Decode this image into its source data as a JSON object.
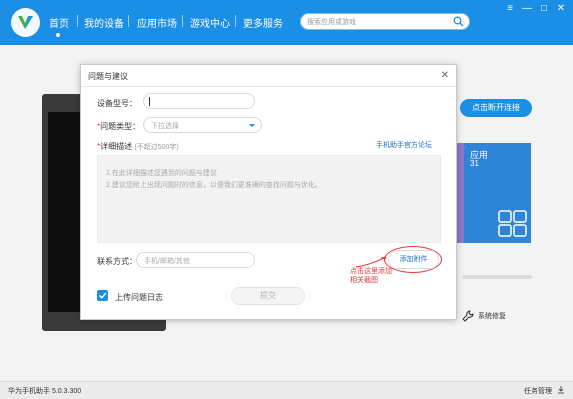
{
  "nav": {
    "items": [
      {
        "label": "首页"
      },
      {
        "label": "我的设备"
      },
      {
        "label": "应用市场"
      },
      {
        "label": "游戏中心"
      },
      {
        "label": "更多服务"
      }
    ],
    "search_placeholder": "搜索应用或游戏"
  },
  "window_controls": {
    "menu": "≡",
    "minimize": "—",
    "maximize": "□",
    "close": "✕"
  },
  "main": {
    "disconnect_button": "点击断开连接",
    "app_tile_title": "应用",
    "app_tile_count": "31",
    "system_repair": "系统修复"
  },
  "dialog": {
    "title": "问题与建议",
    "close": "✕",
    "device_model_label": "设备型号：",
    "issue_type_label": "问题类型：",
    "issue_type_placeholder": "下拉选择",
    "detail_label": "详细描述",
    "detail_hint": "(不超过500字)",
    "forum_link": "手机助手官方论坛",
    "textarea_lines": [
      "1.在此详细描述您遇到的问题与建议",
      "2.建议您附上出现问题时的信息，以便我们更准确的查找问题与优化。"
    ],
    "contact_label": "联系方式：",
    "contact_placeholder": "手机/邮箱/其他",
    "add_attachment": "添加附件",
    "upload_log_label": "上传问题日志",
    "submit": "提交"
  },
  "annotation": {
    "line1": "点击这里添加",
    "line2": "相关截图"
  },
  "status": {
    "version": "华为手机助手 5.0.3.300",
    "task_manager": "任务管理"
  },
  "colors": {
    "brand_blue": "#1b8fe6",
    "annotation_red": "#e23a3a",
    "tile_purple": "#8c79c9",
    "tile_blue": "#2d84d8"
  },
  "icons": [
    "logo-icon",
    "search-icon",
    "menu-icon",
    "minimize-icon",
    "maximize-icon",
    "close-icon",
    "dropdown-arrow-icon",
    "check-icon",
    "wrench-icon",
    "download-icon"
  ]
}
